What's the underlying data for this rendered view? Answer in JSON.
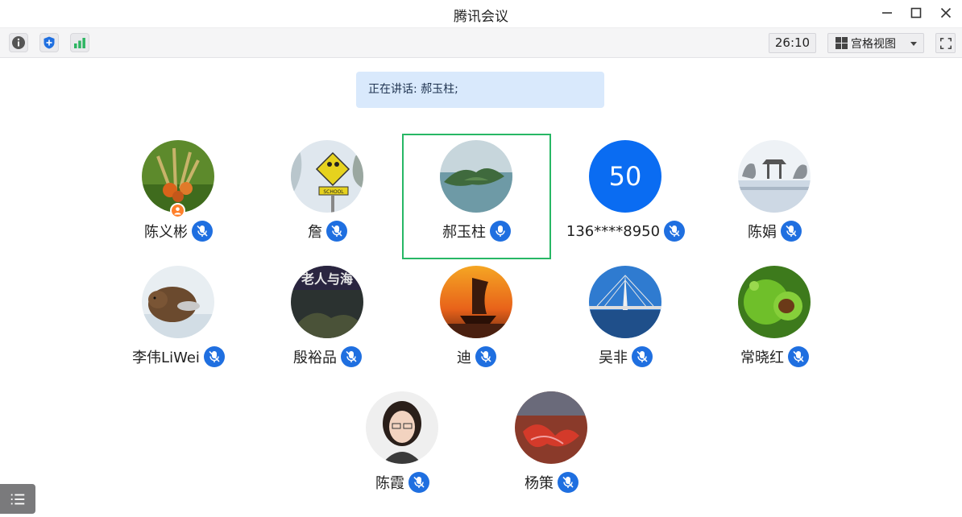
{
  "window": {
    "title": "腾讯会议",
    "controls": [
      "minimize-icon",
      "maximize-icon",
      "close-icon"
    ]
  },
  "toolbar": {
    "icons": [
      "info-icon",
      "shield-icon",
      "signal-icon"
    ],
    "timer": "26:10",
    "view_label": "宫格视图"
  },
  "speaking": {
    "text": "正在讲话: 郝玉柱;"
  },
  "participants": [
    {
      "name": "陈义彬",
      "mic": "mic-muted-icon",
      "host": true
    },
    {
      "name": "詹",
      "mic": "mic-muted-icon"
    },
    {
      "name": "郝玉柱",
      "mic": "mic-active-icon",
      "speaking": true
    },
    {
      "name": "136****8950",
      "mic": "mic-muted-icon",
      "avatar_text": "50"
    },
    {
      "name": "陈娟",
      "mic": "mic-muted-icon"
    },
    {
      "name": "李伟LiWei",
      "mic": "mic-muted-icon"
    },
    {
      "name": "殷裕品",
      "mic": "mic-muted-icon"
    },
    {
      "name": "迪",
      "mic": "mic-muted-icon"
    },
    {
      "name": "吴非",
      "mic": "mic-muted-icon"
    },
    {
      "name": "常晓红",
      "mic": "mic-muted-icon"
    },
    {
      "name": "陈霞",
      "mic": "mic-muted-icon"
    },
    {
      "name": "杨策",
      "mic": "mic-muted-icon"
    }
  ],
  "colors": {
    "accent": "#1f6fe0",
    "active_border": "#27b765",
    "banner_bg": "#d9e9fc",
    "number_avatar_bg": "#0a6cf2",
    "host_badge": "#ff7f2a"
  }
}
